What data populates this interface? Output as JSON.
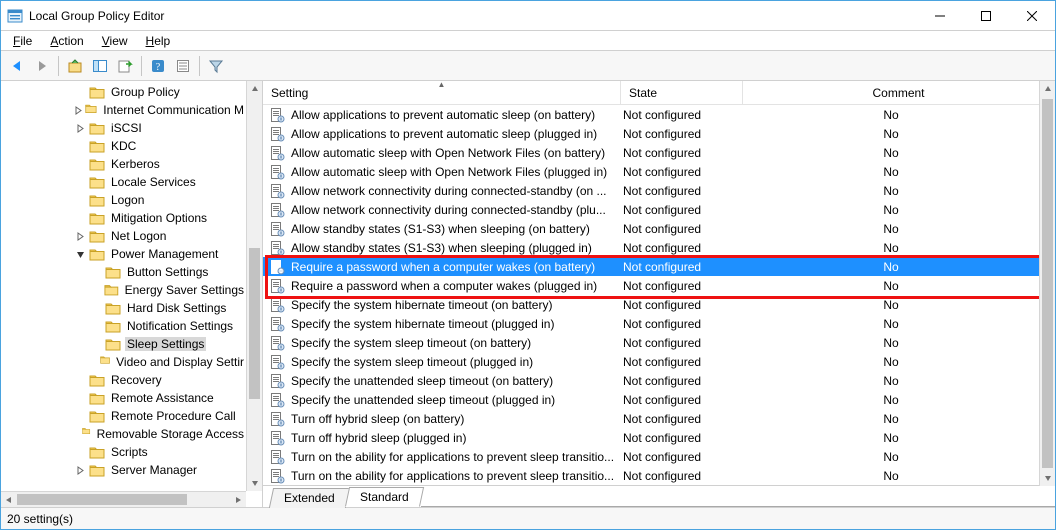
{
  "window": {
    "title": "Local Group Policy Editor"
  },
  "menus": {
    "file": "File",
    "action": "Action",
    "view": "View",
    "help": "Help"
  },
  "tree": [
    {
      "d": 4,
      "e": "",
      "t": "Group Policy"
    },
    {
      "d": 4,
      "e": ">",
      "t": "Internet Communication M"
    },
    {
      "d": 4,
      "e": ">",
      "t": "iSCSI"
    },
    {
      "d": 4,
      "e": "",
      "t": "KDC"
    },
    {
      "d": 4,
      "e": "",
      "t": "Kerberos"
    },
    {
      "d": 4,
      "e": "",
      "t": "Locale Services"
    },
    {
      "d": 4,
      "e": "",
      "t": "Logon"
    },
    {
      "d": 4,
      "e": "",
      "t": "Mitigation Options"
    },
    {
      "d": 4,
      "e": ">",
      "t": "Net Logon"
    },
    {
      "d": 4,
      "e": "v",
      "t": "Power Management"
    },
    {
      "d": 5,
      "e": "",
      "t": "Button Settings"
    },
    {
      "d": 5,
      "e": "",
      "t": "Energy Saver Settings"
    },
    {
      "d": 5,
      "e": "",
      "t": "Hard Disk Settings"
    },
    {
      "d": 5,
      "e": "",
      "t": "Notification Settings"
    },
    {
      "d": 5,
      "e": "",
      "t": "Sleep Settings",
      "sel": true
    },
    {
      "d": 5,
      "e": "",
      "t": "Video and Display Settir"
    },
    {
      "d": 4,
      "e": "",
      "t": "Recovery"
    },
    {
      "d": 4,
      "e": "",
      "t": "Remote Assistance"
    },
    {
      "d": 4,
      "e": "",
      "t": "Remote Procedure Call"
    },
    {
      "d": 4,
      "e": "",
      "t": "Removable Storage Access"
    },
    {
      "d": 4,
      "e": "",
      "t": "Scripts"
    },
    {
      "d": 4,
      "e": ">",
      "t": "Server Manager"
    }
  ],
  "columns": {
    "c1": "Setting",
    "c2": "State",
    "c3": "Comment"
  },
  "rows": [
    {
      "t": "Allow applications to prevent automatic sleep (on battery)",
      "s": "Not configured",
      "c": "No"
    },
    {
      "t": "Allow applications to prevent automatic sleep (plugged in)",
      "s": "Not configured",
      "c": "No"
    },
    {
      "t": "Allow automatic sleep with Open Network Files (on battery)",
      "s": "Not configured",
      "c": "No"
    },
    {
      "t": "Allow automatic sleep with Open Network Files (plugged in)",
      "s": "Not configured",
      "c": "No"
    },
    {
      "t": "Allow network connectivity during connected-standby (on ...",
      "s": "Not configured",
      "c": "No"
    },
    {
      "t": "Allow network connectivity during connected-standby (plu...",
      "s": "Not configured",
      "c": "No"
    },
    {
      "t": "Allow standby states (S1-S3) when sleeping (on battery)",
      "s": "Not configured",
      "c": "No"
    },
    {
      "t": "Allow standby states (S1-S3) when sleeping (plugged in)",
      "s": "Not configured",
      "c": "No"
    },
    {
      "t": "Require a password when a computer wakes (on battery)",
      "s": "Not configured",
      "c": "No",
      "sel": true
    },
    {
      "t": "Require a password when a computer wakes (plugged in)",
      "s": "Not configured",
      "c": "No"
    },
    {
      "t": "Specify the system hibernate timeout (on battery)",
      "s": "Not configured",
      "c": "No"
    },
    {
      "t": "Specify the system hibernate timeout (plugged in)",
      "s": "Not configured",
      "c": "No"
    },
    {
      "t": "Specify the system sleep timeout (on battery)",
      "s": "Not configured",
      "c": "No"
    },
    {
      "t": "Specify the system sleep timeout (plugged in)",
      "s": "Not configured",
      "c": "No"
    },
    {
      "t": "Specify the unattended sleep timeout (on battery)",
      "s": "Not configured",
      "c": "No"
    },
    {
      "t": "Specify the unattended sleep timeout (plugged in)",
      "s": "Not configured",
      "c": "No"
    },
    {
      "t": "Turn off hybrid sleep (on battery)",
      "s": "Not configured",
      "c": "No"
    },
    {
      "t": "Turn off hybrid sleep (plugged in)",
      "s": "Not configured",
      "c": "No"
    },
    {
      "t": "Turn on the ability for applications to prevent sleep transitio...",
      "s": "Not configured",
      "c": "No"
    },
    {
      "t": "Turn on the ability for applications to prevent sleep transitio...",
      "s": "Not configured",
      "c": "No"
    }
  ],
  "tabs": {
    "extended": "Extended",
    "standard": "Standard"
  },
  "status": "20 setting(s)"
}
